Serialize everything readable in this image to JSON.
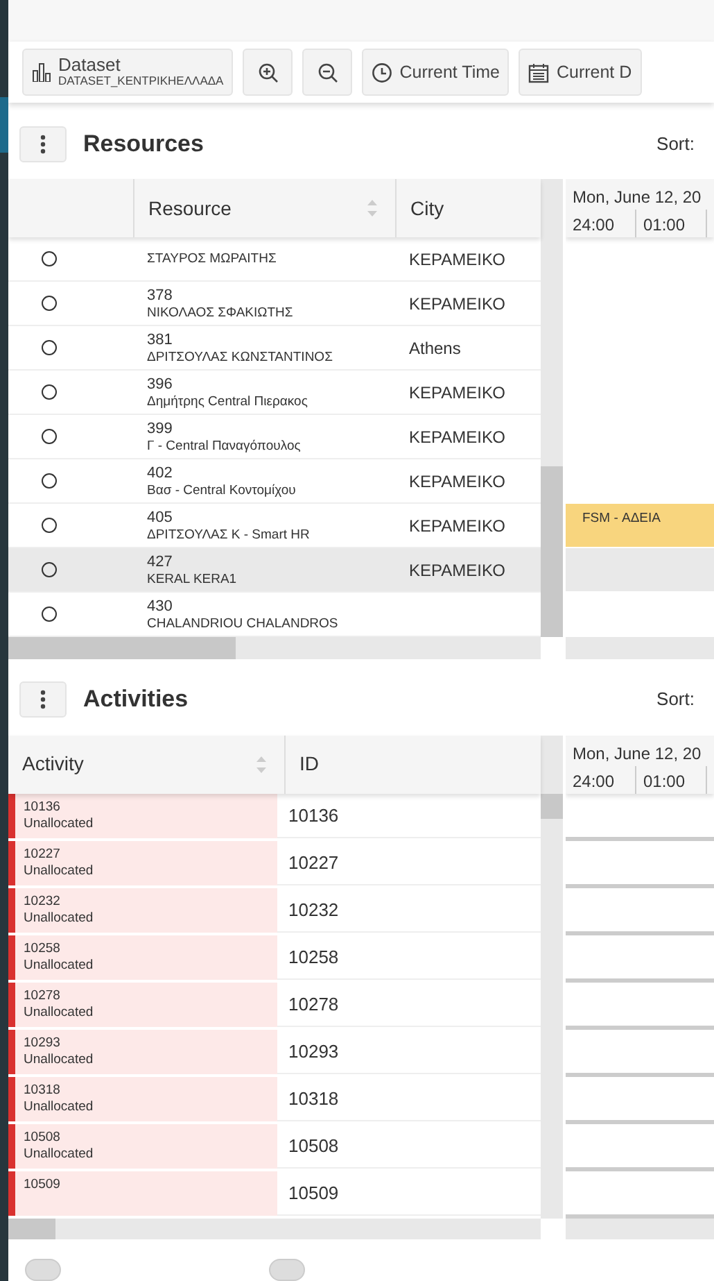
{
  "toolbar": {
    "dataset_label": "Dataset",
    "dataset_value": "DATASET_ΚΕΝΤΡΙΚΗΕΛΛΑΔΑ",
    "buttons": [
      {
        "kind": "zoom-in"
      },
      {
        "kind": "zoom-out"
      },
      {
        "kind": "clock",
        "label": "Current Time"
      },
      {
        "kind": "calendar",
        "label": "Current D"
      }
    ]
  },
  "resources": {
    "title": "Resources",
    "sort_label": "Sort:",
    "columns": [
      "Resource",
      "City"
    ],
    "gantt_date": "Mon, June 12, 20",
    "gantt_times": [
      "24:00",
      "01:00"
    ],
    "rows": [
      {
        "name": "ΣΤΑΥΡΟΣ ΜΩΡΑΙΤΗΣ",
        "city": "ΚΕΡΑΜΕΙΚΟ",
        "selected": false
      },
      {
        "number": "378",
        "name": "ΝΙΚΟΛΑΟΣ ΣΦΑΚΙΩΤΗΣ",
        "city": "ΚΕΡΑΜΕΙΚΟ",
        "selected": false
      },
      {
        "number": "381",
        "name": "ΔΡΙΤΣΟΥΛΑΣ ΚΩΝΣΤΑΝΤΙΝΟΣ",
        "city": "Athens",
        "selected": false
      },
      {
        "number": "396",
        "name": "Δημήτρης Central Πιερακος",
        "city": "ΚΕΡΑΜΕΙΚΟ",
        "selected": false
      },
      {
        "number": "399",
        "name": "Γ - Central Παναγόπουλος",
        "city": "ΚΕΡΑΜΕΙΚΟ",
        "selected": false
      },
      {
        "number": "402",
        "name": "Βασ - Central Κοντομίχου",
        "city": "ΚΕΡΑΜΕΙΚΟ",
        "selected": false
      },
      {
        "number": "405",
        "name": "ΔΡΙΤΣΟΥΛΑΣ Κ - Smart HR",
        "city": "ΚΕΡΑΜΕΙΚΟ",
        "selected": false,
        "event": {
          "label": "FSM - ΑΔΕΙΑ",
          "color": "#f8d57e"
        }
      },
      {
        "number": "427",
        "name": "KERAL KERA1",
        "city": "ΚΕΡΑΜΕΙΚΟ",
        "selected": true
      },
      {
        "number": "430",
        "name": "CHALANDRIOU CHALANDROS",
        "selected": false
      }
    ]
  },
  "activities": {
    "title": "Activities",
    "sort_label": "Sort:",
    "columns": [
      "Activity",
      "ID"
    ],
    "gantt_date": "Mon, June 12, 20",
    "gantt_times": [
      "24:00",
      "01:00"
    ],
    "rows": [
      {
        "number": "10136",
        "status": "Unallocated",
        "id": "10136"
      },
      {
        "number": "10227",
        "status": "Unallocated",
        "id": "10227"
      },
      {
        "number": "10232",
        "status": "Unallocated",
        "id": "10232"
      },
      {
        "number": "10258",
        "status": "Unallocated",
        "id": "10258"
      },
      {
        "number": "10278",
        "status": "Unallocated",
        "id": "10278"
      },
      {
        "number": "10293",
        "status": "Unallocated",
        "id": "10293"
      },
      {
        "number": "10318",
        "status": "Unallocated",
        "id": "10318"
      },
      {
        "number": "10508",
        "status": "Unallocated",
        "id": "10508"
      },
      {
        "number": "10509",
        "id": "10509"
      }
    ]
  },
  "toggles": [
    {
      "on": false
    },
    {
      "on": false
    }
  ]
}
